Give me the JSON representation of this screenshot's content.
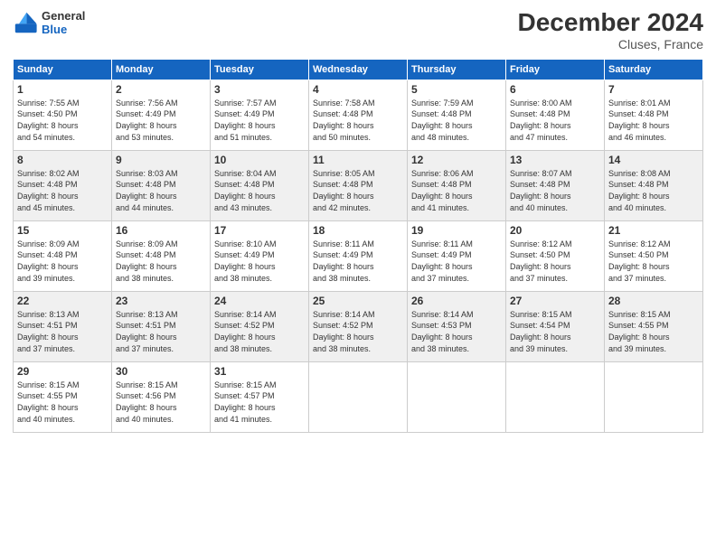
{
  "header": {
    "logo_line1": "General",
    "logo_line2": "Blue",
    "main_title": "December 2024",
    "subtitle": "Cluses, France"
  },
  "calendar": {
    "days_of_week": [
      "Sunday",
      "Monday",
      "Tuesday",
      "Wednesday",
      "Thursday",
      "Friday",
      "Saturday"
    ],
    "weeks": [
      [
        null,
        null,
        {
          "day": 3,
          "sunrise": "7:57 AM",
          "sunset": "4:49 PM",
          "daylight": "8 hours and 51 minutes."
        },
        {
          "day": 4,
          "sunrise": "7:58 AM",
          "sunset": "4:48 PM",
          "daylight": "8 hours and 50 minutes."
        },
        {
          "day": 5,
          "sunrise": "7:59 AM",
          "sunset": "4:48 PM",
          "daylight": "8 hours and 48 minutes."
        },
        {
          "day": 6,
          "sunrise": "8:00 AM",
          "sunset": "4:48 PM",
          "daylight": "8 hours and 47 minutes."
        },
        {
          "day": 7,
          "sunrise": "8:01 AM",
          "sunset": "4:48 PM",
          "daylight": "8 hours and 46 minutes."
        }
      ],
      [
        {
          "day": 1,
          "sunrise": "7:55 AM",
          "sunset": "4:50 PM",
          "daylight": "8 hours and 54 minutes."
        },
        {
          "day": 2,
          "sunrise": "7:56 AM",
          "sunset": "4:49 PM",
          "daylight": "8 hours and 53 minutes."
        },
        null,
        null,
        null,
        null,
        null
      ],
      [
        {
          "day": 8,
          "sunrise": "8:02 AM",
          "sunset": "4:48 PM",
          "daylight": "8 hours and 45 minutes."
        },
        {
          "day": 9,
          "sunrise": "8:03 AM",
          "sunset": "4:48 PM",
          "daylight": "8 hours and 44 minutes."
        },
        {
          "day": 10,
          "sunrise": "8:04 AM",
          "sunset": "4:48 PM",
          "daylight": "8 hours and 43 minutes."
        },
        {
          "day": 11,
          "sunrise": "8:05 AM",
          "sunset": "4:48 PM",
          "daylight": "8 hours and 42 minutes."
        },
        {
          "day": 12,
          "sunrise": "8:06 AM",
          "sunset": "4:48 PM",
          "daylight": "8 hours and 41 minutes."
        },
        {
          "day": 13,
          "sunrise": "8:07 AM",
          "sunset": "4:48 PM",
          "daylight": "8 hours and 40 minutes."
        },
        {
          "day": 14,
          "sunrise": "8:08 AM",
          "sunset": "4:48 PM",
          "daylight": "8 hours and 40 minutes."
        }
      ],
      [
        {
          "day": 15,
          "sunrise": "8:09 AM",
          "sunset": "4:48 PM",
          "daylight": "8 hours and 39 minutes."
        },
        {
          "day": 16,
          "sunrise": "8:09 AM",
          "sunset": "4:48 PM",
          "daylight": "8 hours and 38 minutes."
        },
        {
          "day": 17,
          "sunrise": "8:10 AM",
          "sunset": "4:49 PM",
          "daylight": "8 hours and 38 minutes."
        },
        {
          "day": 18,
          "sunrise": "8:11 AM",
          "sunset": "4:49 PM",
          "daylight": "8 hours and 38 minutes."
        },
        {
          "day": 19,
          "sunrise": "8:11 AM",
          "sunset": "4:49 PM",
          "daylight": "8 hours and 37 minutes."
        },
        {
          "day": 20,
          "sunrise": "8:12 AM",
          "sunset": "4:50 PM",
          "daylight": "8 hours and 37 minutes."
        },
        {
          "day": 21,
          "sunrise": "8:12 AM",
          "sunset": "4:50 PM",
          "daylight": "8 hours and 37 minutes."
        }
      ],
      [
        {
          "day": 22,
          "sunrise": "8:13 AM",
          "sunset": "4:51 PM",
          "daylight": "8 hours and 37 minutes."
        },
        {
          "day": 23,
          "sunrise": "8:13 AM",
          "sunset": "4:51 PM",
          "daylight": "8 hours and 37 minutes."
        },
        {
          "day": 24,
          "sunrise": "8:14 AM",
          "sunset": "4:52 PM",
          "daylight": "8 hours and 38 minutes."
        },
        {
          "day": 25,
          "sunrise": "8:14 AM",
          "sunset": "4:52 PM",
          "daylight": "8 hours and 38 minutes."
        },
        {
          "day": 26,
          "sunrise": "8:14 AM",
          "sunset": "4:53 PM",
          "daylight": "8 hours and 38 minutes."
        },
        {
          "day": 27,
          "sunrise": "8:15 AM",
          "sunset": "4:54 PM",
          "daylight": "8 hours and 39 minutes."
        },
        {
          "day": 28,
          "sunrise": "8:15 AM",
          "sunset": "4:55 PM",
          "daylight": "8 hours and 39 minutes."
        }
      ],
      [
        {
          "day": 29,
          "sunrise": "8:15 AM",
          "sunset": "4:55 PM",
          "daylight": "8 hours and 40 minutes."
        },
        {
          "day": 30,
          "sunrise": "8:15 AM",
          "sunset": "4:56 PM",
          "daylight": "8 hours and 40 minutes."
        },
        {
          "day": 31,
          "sunrise": "8:15 AM",
          "sunset": "4:57 PM",
          "daylight": "8 hours and 41 minutes."
        },
        null,
        null,
        null,
        null
      ]
    ]
  }
}
